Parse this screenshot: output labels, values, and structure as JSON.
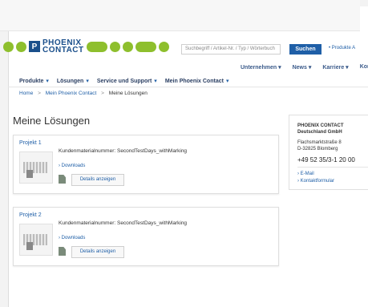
{
  "header": {
    "logo_text_line1": "PHOENIX",
    "logo_text_line2": "CONTACT",
    "search_placeholder": "Suchbegriff / Artikel-Nr. / Typ / Wörterbuch",
    "search_button": "Suchen",
    "products_link": "• Produkte A"
  },
  "top_nav": [
    {
      "label": "Unternehmen",
      "caret": "▾"
    },
    {
      "label": "News",
      "caret": "▾"
    },
    {
      "label": "Karriere",
      "caret": "▾"
    },
    {
      "label": "Kontakt"
    }
  ],
  "main_nav": [
    {
      "label": "Produkte",
      "caret": "▾"
    },
    {
      "label": "Lösungen",
      "caret": "▾"
    },
    {
      "label": "Service und Support",
      "caret": "▾"
    },
    {
      "label": "Mein Phoenix Contact",
      "caret": "▾"
    }
  ],
  "breadcrumb": {
    "home": "Home",
    "sep": ">",
    "section": "Mein Phoenix Contact",
    "current": "Meine Lösungen"
  },
  "page_title": "Meine Lösungen",
  "projects": [
    {
      "title": "Projekt 1",
      "material_label": "Kundenmaterialnummer: SecondTestDays_withMarking",
      "download_label": "› Downloads",
      "details_label": "Details anzeigen"
    },
    {
      "title": "Projekt 2",
      "material_label": "Kundenmaterialnummer: SecondTestDays_withMarking",
      "download_label": "› Downloads",
      "details_label": "Details anzeigen"
    }
  ],
  "contact": {
    "org_line1": "PHOENIX CONTACT",
    "org_line2": "Deutschland GmbH",
    "addr_line1": "Flachsmarktstraße 8",
    "addr_line2": "D-32825 Blomberg",
    "phone": "+49 52 35/3-1 20 00",
    "email_link": "› E-Mail",
    "form_link": "› Kontaktformular"
  }
}
